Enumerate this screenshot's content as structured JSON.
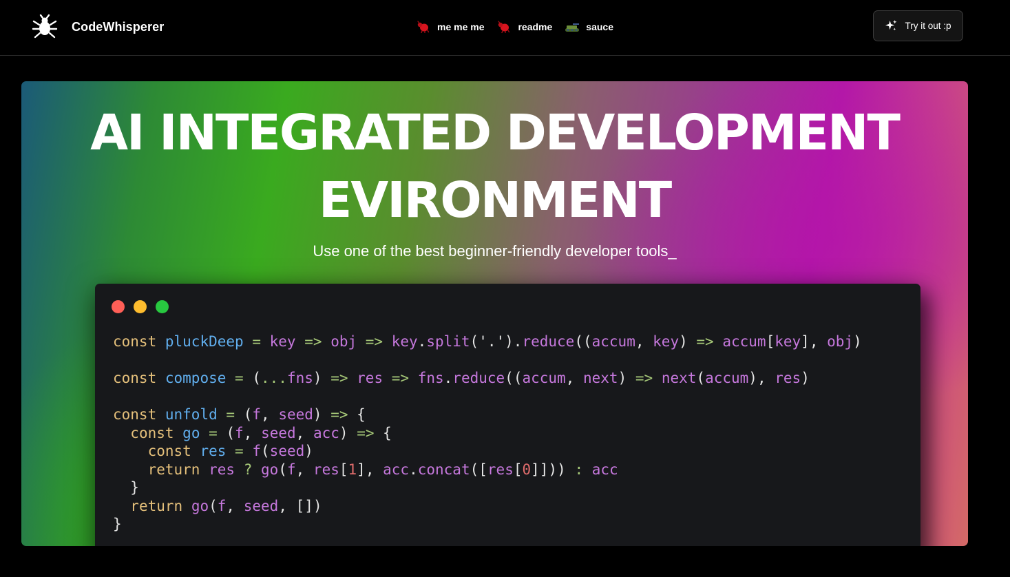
{
  "nav": {
    "brand_name": "CodeWhisperer",
    "brand_icon": "bug-icon",
    "links": [
      {
        "label": "me me me",
        "icon": "red-bug-icon"
      },
      {
        "label": "readme",
        "icon": "red-bug-icon"
      },
      {
        "label": "sauce",
        "icon": "green-tank-icon"
      }
    ],
    "cta_label": "Try it out :p",
    "cta_icon": "sparkle-icon"
  },
  "hero": {
    "title_line1": "AI INTEGRATED DEVELOPMENT",
    "title_line2": "EVIRONMENT",
    "subtitle": "Use one of the best beginner-friendly developer tools_"
  },
  "code_window": {
    "dots": [
      "close-dot",
      "minimize-dot",
      "maximize-dot"
    ],
    "colors": {
      "red": "#ff5f57",
      "yellow": "#febc2e",
      "green": "#28c840"
    },
    "lines": [
      "const pluckDeep = key => obj => key.split('.').reduce((accum, key) => accum[key], obj)",
      "",
      "const compose = (...fns) => res => fns.reduce((accum, next) => next(accum), res)",
      "",
      "const unfold = (f, seed) => {",
      "  const go = (f, seed, acc) => {",
      "    const res = f(seed)",
      "    return res ? go(f, res[1], acc.concat([res[0]])) : acc",
      "  }",
      "  return go(f, seed, [])",
      "}"
    ]
  }
}
